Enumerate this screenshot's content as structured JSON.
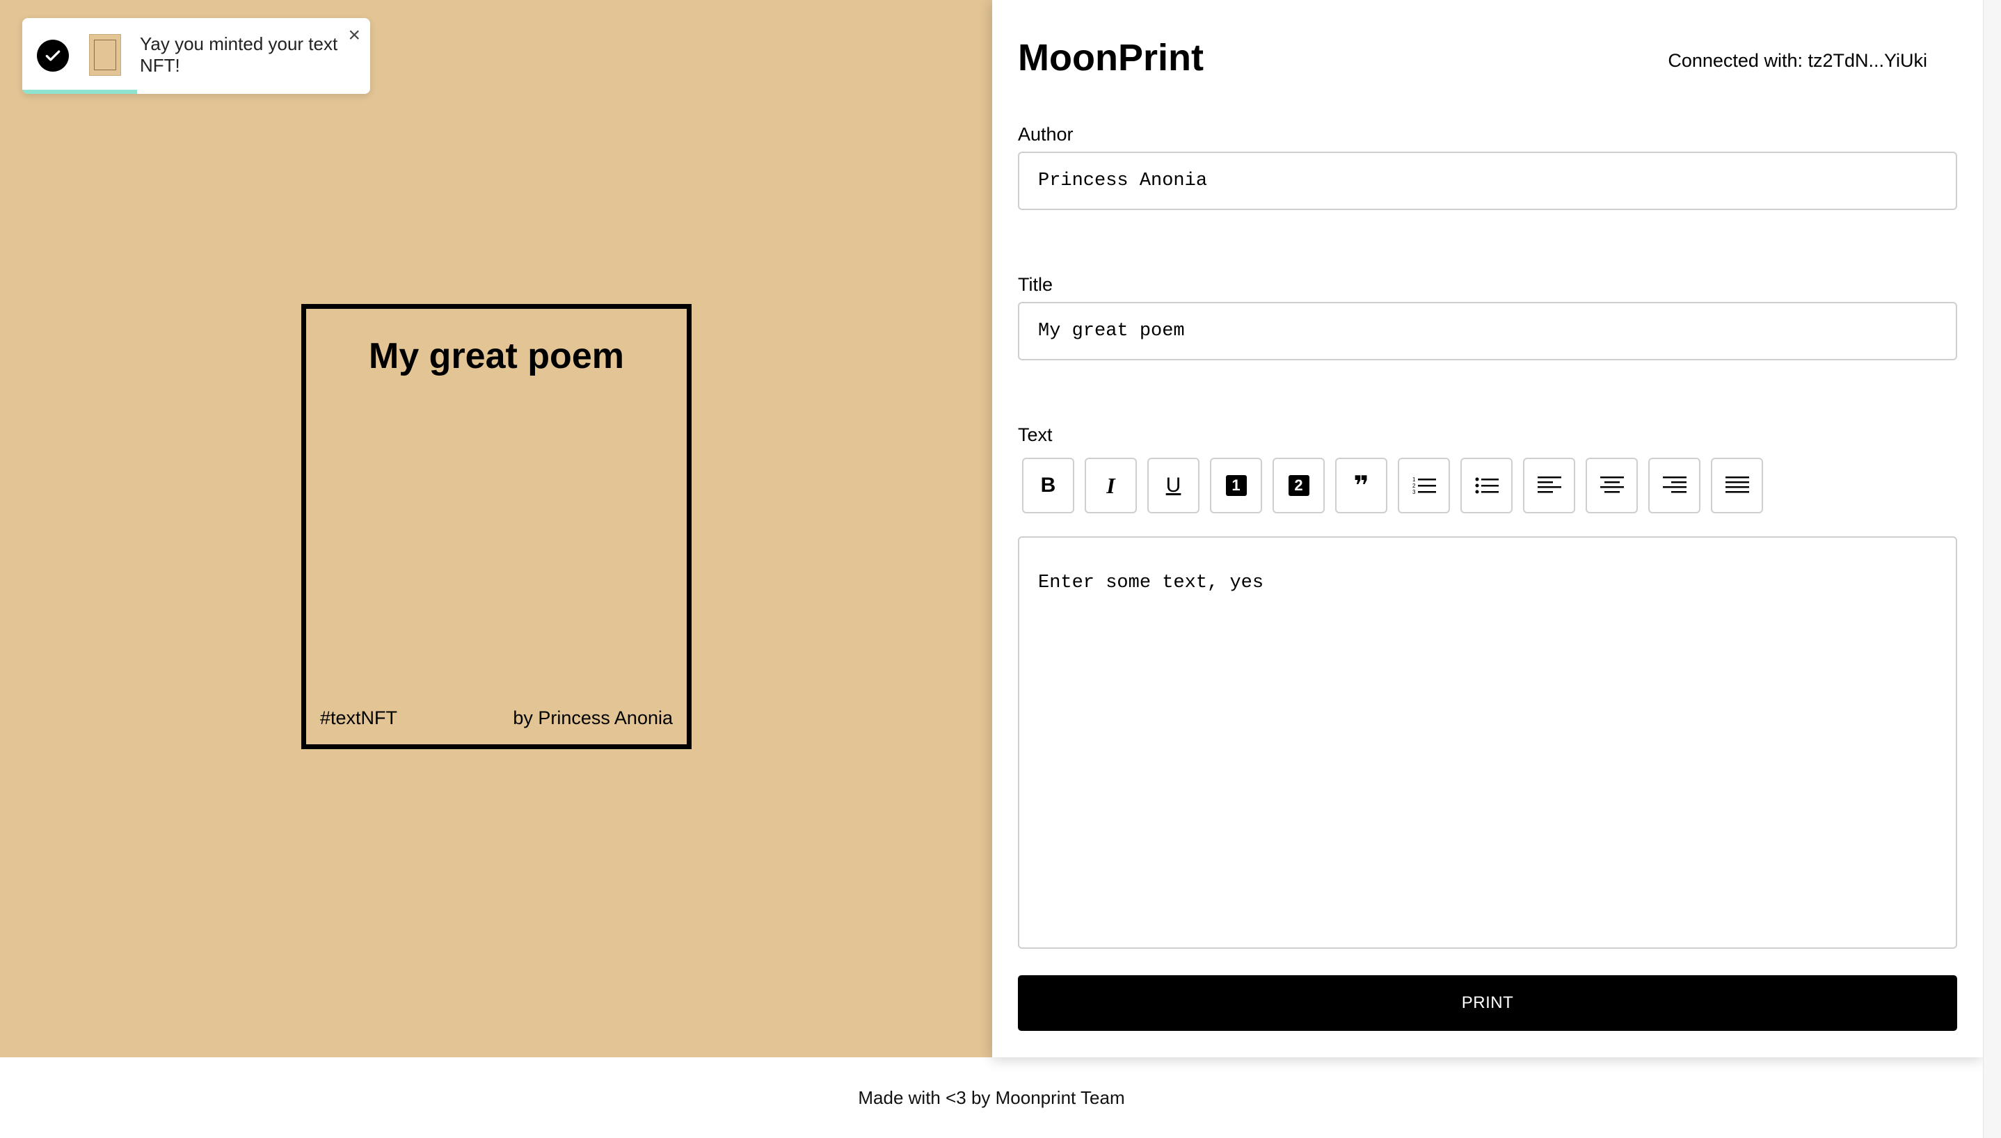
{
  "toast": {
    "message": "Yay you minted your text NFT!",
    "close": "×",
    "progress": 0.33,
    "check_icon": "check-circle-icon",
    "thumb_icon": "nft-thumbnail-icon"
  },
  "preview": {
    "background": "#e2c495",
    "title": "My great poem",
    "tag": "#textNFT",
    "author": "by Princess Anonia"
  },
  "app": {
    "title": "MoonPrint",
    "connected": "Connected with: tz2TdN...YiUki"
  },
  "form": {
    "author_label": "Author",
    "author_value": "Princess Anonia",
    "title_label": "Title",
    "title_value": "My great poem",
    "text_label": "Text",
    "text_value": "Enter some text, yes",
    "print_label": "PRINT"
  },
  "toolbar": {
    "bold": "B",
    "italic": "I",
    "underline": "U",
    "heading1": "1",
    "heading2": "2",
    "quote": "❞",
    "icons": [
      "bold-icon",
      "italic-icon",
      "underline-icon",
      "heading-1-icon",
      "heading-2-icon",
      "quote-icon",
      "ordered-list-icon",
      "bullet-list-icon",
      "align-left-icon",
      "align-center-icon",
      "align-right-icon",
      "align-justify-icon"
    ]
  },
  "footer": {
    "text": "Made with <3 by Moonprint Team"
  }
}
